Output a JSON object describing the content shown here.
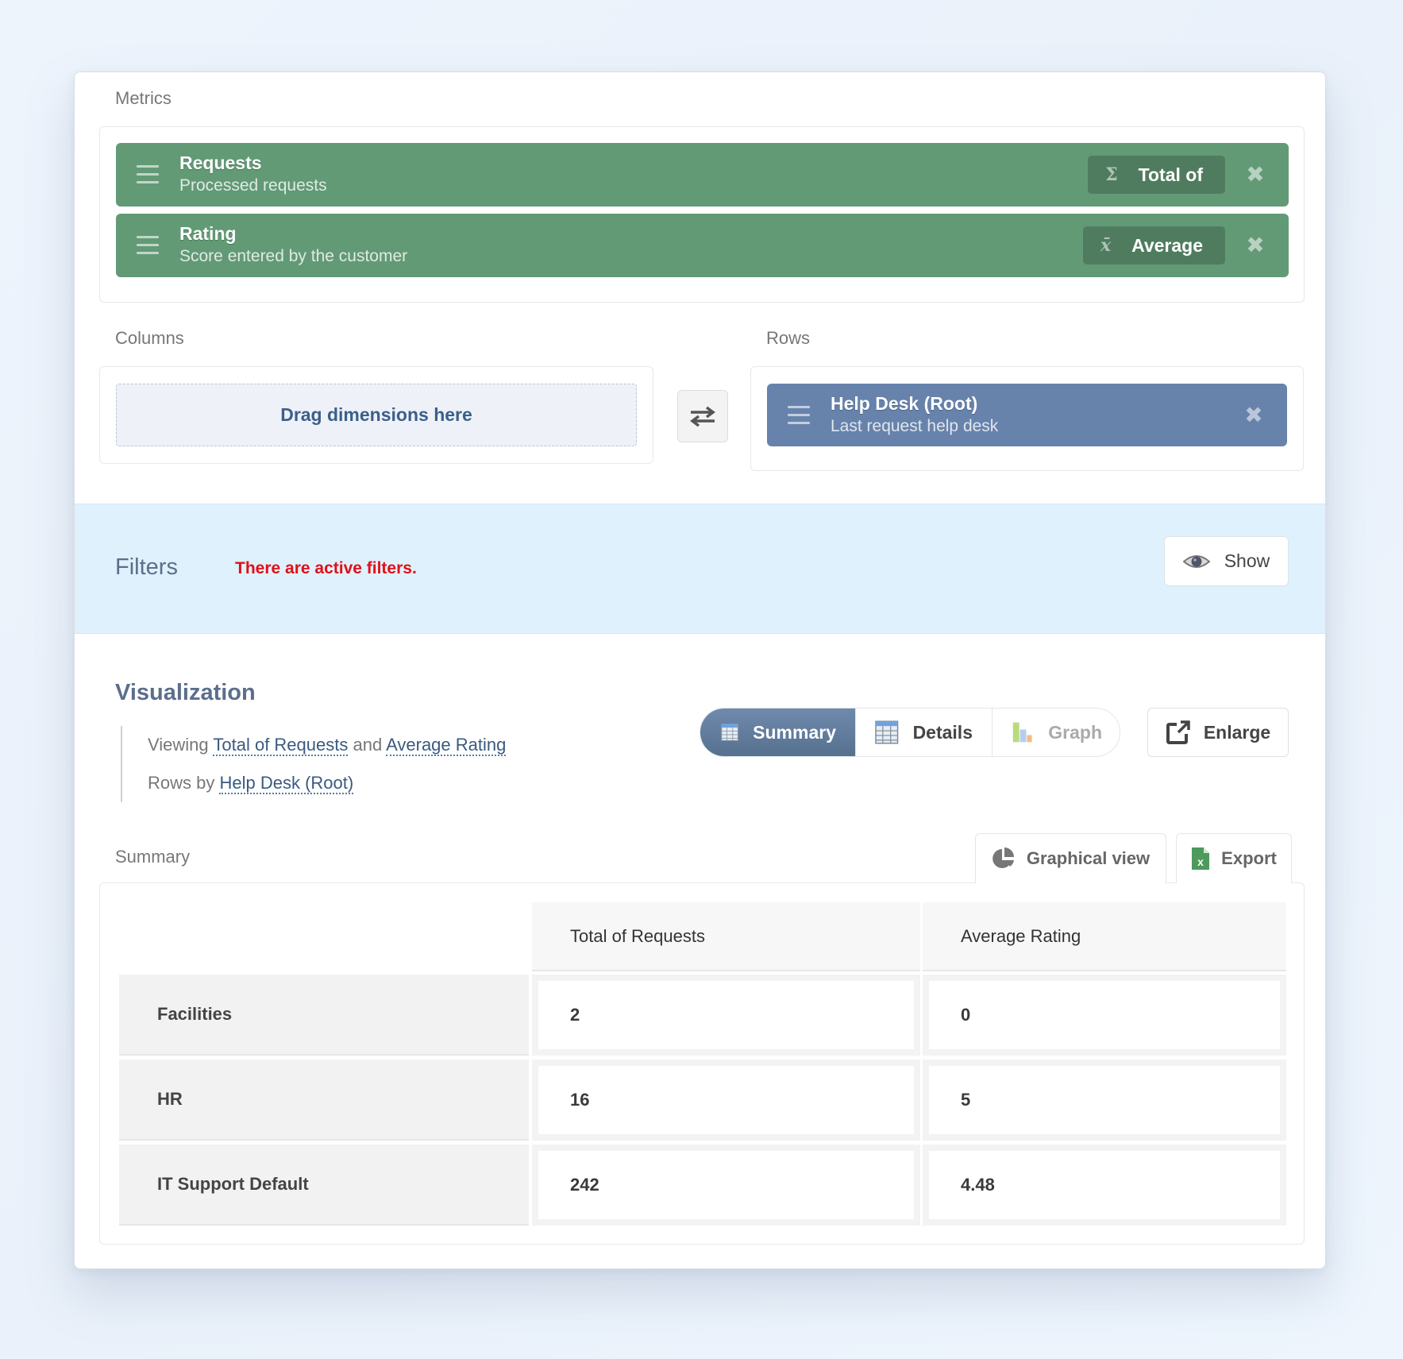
{
  "metrics": {
    "label": "Metrics",
    "items": [
      {
        "title": "Requests",
        "subtitle": "Processed requests",
        "aggregation": "Total of",
        "aggregation_icon": "sigma-icon",
        "aggregation_glyph": "Σ"
      },
      {
        "title": "Rating",
        "subtitle": "Score entered by the customer",
        "aggregation": "Average",
        "aggregation_icon": "mean-icon",
        "aggregation_glyph": "x̄"
      }
    ],
    "close_glyph": "✖"
  },
  "columns": {
    "label": "Columns",
    "dropzone": "Drag dimensions here"
  },
  "rows": {
    "label": "Rows",
    "items": [
      {
        "title": "Help Desk (Root)",
        "subtitle": "Last request help desk"
      }
    ]
  },
  "filters": {
    "title": "Filters",
    "message": "There are active filters.",
    "message_color": "#e0101a",
    "show_label": "Show"
  },
  "visualization": {
    "title": "Visualization",
    "viewing_prefix": "Viewing",
    "metric1": "Total of Requests",
    "joiner": "and",
    "metric2": "Average Rating",
    "rows_prefix": "Rows by",
    "rows_dim": "Help Desk (Root)",
    "modes": [
      {
        "label": "Summary",
        "icon": "table-icon",
        "active": true
      },
      {
        "label": "Details",
        "icon": "table-icon",
        "active": false
      },
      {
        "label": "Graph",
        "icon": "bar-chart-icon",
        "active": false,
        "disabled": true
      }
    ],
    "enlarge_label": "Enlarge"
  },
  "summary": {
    "label": "Summary",
    "graphical_view_label": "Graphical view",
    "export_label": "Export",
    "columns": [
      "",
      "Total of Requests",
      "Average Rating"
    ],
    "rows": [
      {
        "label": "Facilities",
        "total_requests": "2",
        "average_rating": "0"
      },
      {
        "label": "HR",
        "total_requests": "16",
        "average_rating": "5"
      },
      {
        "label": "IT Support Default",
        "total_requests": "242",
        "average_rating": "4.48"
      }
    ]
  },
  "colors": {
    "metric_chip": "#629a76",
    "dimension_chip": "#6783ac",
    "filters_band": "#dff1fc",
    "active_mode": "#647fa1"
  }
}
